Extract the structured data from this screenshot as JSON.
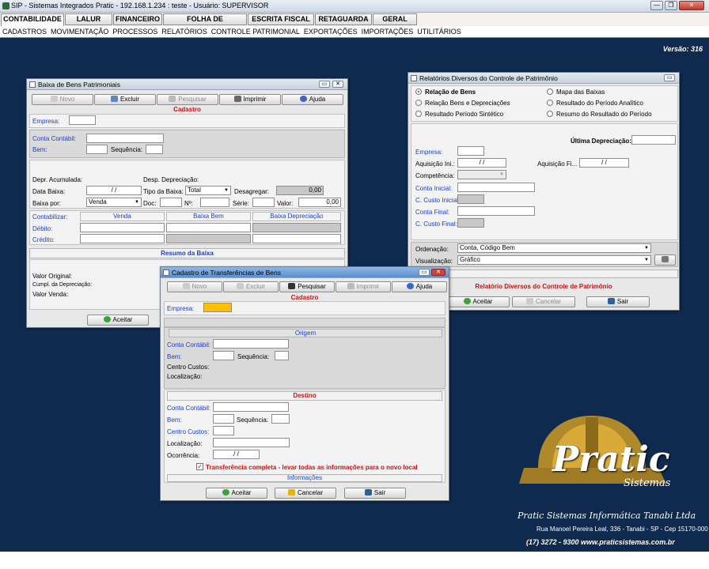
{
  "app": {
    "title": "SIP - Sistemas Integrados Pratic - 192.168.1.234 : teste - Usuário: SUPERVISOR",
    "minimize": "—",
    "restore": "❐",
    "close": "✕"
  },
  "main_tabs": [
    "CONTABILIDADE",
    "LALUR",
    "FINANCEIRO",
    "FOLHA DE PAGAMENTO",
    "ESCRITA FISCAL",
    "RETAGUARDA",
    "GERAL"
  ],
  "submenu": [
    "CADASTROS",
    "MOVIMENTAÇÃO",
    "PROCESSOS",
    "RELATÓRIOS",
    "CONTROLE PATRIMONIAL",
    "EXPORTAÇÕES",
    "IMPORTAÇÕES",
    "UTILITÁRIOS"
  ],
  "version": "Versão: 316",
  "baixa": {
    "title": "Baixa de Bens Patrimoniais",
    "toolbar": {
      "novo": "Novo",
      "excluir": "Excluir",
      "pesquisar": "Pesquisar",
      "imprimir": "Imprimir",
      "ajuda": "Ajuda"
    },
    "header": "Cadastro",
    "empresa": "Empresa:",
    "conta_contabil": "Conta Contábil:",
    "bem": "Bem:",
    "sequencia": "Sequência:",
    "depr_acumulada": "Depr. Acumulada:",
    "desp_depreciacao": "Desp. Depreciação:",
    "data_baixa": "Data Baixa:",
    "data_baixa_value": "/ /",
    "tipo_baixa": "Tipo da Baixa:",
    "tipo_baixa_value": "Total",
    "desagregar": "Desagregar:",
    "desagregar_value": "0,00",
    "baixa_por": "Baixa por:",
    "baixa_por_value": "Venda",
    "doc": "Doc:",
    "no": "Nº:",
    "serie": "Série:",
    "valor": "Valor:",
    "valor_value": "0,00",
    "contabilizar": "Contabilizar:",
    "col_venda": "Venda",
    "col_baixa_bem": "Baixa Bem",
    "col_baixa_depr": "Baixa Depreciação",
    "debito": "Débito:",
    "credito": "Crédito:",
    "resumo": "Resumo da Baixa",
    "valor_original": "Valor Original:",
    "cumpl_depr": "Cumpl. da Depreciação:",
    "valor_venda": "Valor Venda:",
    "aceitar": "Aceitar"
  },
  "relatorios": {
    "title": "Relatórios Diversos do Controle de Patrimônio",
    "options": [
      "Relação de Bens",
      "Mapa das Baixas",
      "Relação Bens e Depreciações",
      "Resultado do Período Analítico",
      "Resultado Período Sintético",
      "Resumo do Resultado do Período"
    ],
    "selected": "Relação de Bens",
    "ultima_depreciacao": "Última Depreciação:",
    "empresa": "Empresa:",
    "aquisicao_ini": "Aquisição Ini.:",
    "aquisicao_ini_value": "/ /",
    "aquisicao_fi": "Aquisição Fi...",
    "aquisicao_fi_value": "/ /",
    "competencia": "Competência:",
    "conta_inicial": "Conta Inicial:",
    "c_custo_inicial": "C. Custo Inicial:",
    "conta_final": "Conta Final:",
    "c_custo_final": "C. Custo Final:",
    "ordenacao": "Ordenação:",
    "ordenacao_value": "Conta, Código Bem",
    "visualizacao": "Visualização:",
    "visualizacao_value": "Gráfico",
    "footer_title": "Relatório Diversos do Controle de Patrimônio",
    "aceitar": "Aceitar",
    "cancelar": "Cancelar",
    "sair": "Sair"
  },
  "transf": {
    "title": "Cadastro de Transferências de Bens",
    "toolbar": {
      "novo": "Novo",
      "excluir": "Excluir",
      "pesquisar": "Pesquisar",
      "imprimir": "Imprimir",
      "ajuda": "Ajuda"
    },
    "header": "Cadastro",
    "empresa": "Empresa:",
    "origem": "Origem",
    "conta_contabil": "Conta Contábil:",
    "bem": "Bem:",
    "sequencia": "Sequência:",
    "centro_custos": "Centro Custos:",
    "localizacao": "Localização:",
    "destino": "Destino",
    "d_conta_contabil": "Conta Contábil:",
    "d_bem": "Bem:",
    "d_sequencia": "Sequência:",
    "d_centro_custos": "Centro Custos:",
    "d_localizacao": "Localização:",
    "ocorrencia": "Ocorrência:",
    "ocorrencia_value": "/ /",
    "transferencia": "Transferência completa - levar todas as informações para o novo local",
    "informacoes": "Informações",
    "aceitar": "Aceitar",
    "cancelar": "Cancelar",
    "sair": "Sair"
  },
  "logo": {
    "brand": "Pratic",
    "sub": "Sistemas",
    "company": "Pratic Sistemas Informática Tanabi Ltda",
    "address": "Rua Manoel Pereira Leal, 336 - Tanabi - SP - Cep 15170-000",
    "phone": "(17) 3272 - 9300  www.praticsistemas.com.br"
  },
  "colors": {
    "desktop": "#0e2a4e",
    "accent_red": "#d01010",
    "label_blue": "#1b3fd0",
    "empresa_highlight": "#ffc000"
  }
}
